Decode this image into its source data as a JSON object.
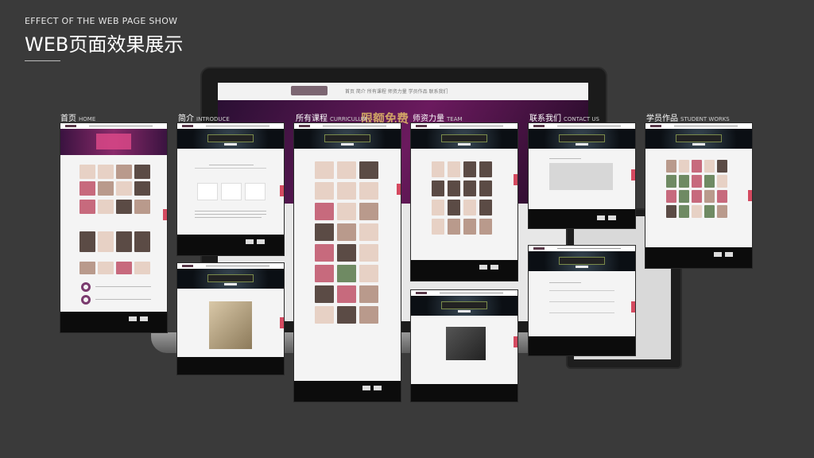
{
  "header": {
    "subtitle": "EFFECT OF THE WEB PAGE SHOW",
    "title": "WEB页面效果展示"
  },
  "background": {
    "nav_text": "首页  简介  所有课程  师资力量  学员作品  联系我们",
    "banner_text": "限额免费"
  },
  "pages": [
    {
      "cn": "首页",
      "en": "HOME"
    },
    {
      "cn": "简介",
      "en": "INTRODUCE"
    },
    {
      "cn": "所有课程",
      "en": "CURRICULUM"
    },
    {
      "cn": "师资力量",
      "en": "TEAM"
    },
    {
      "cn": "联系我们",
      "en": "CONTACT US"
    },
    {
      "cn": "学员作品",
      "en": "STUDENT WORKS"
    }
  ],
  "colors": {
    "background": "#3a3a3a",
    "footer": "#0c0c0c",
    "accent_purple": "#6b1a5e",
    "side_tab": "#d44a60"
  }
}
